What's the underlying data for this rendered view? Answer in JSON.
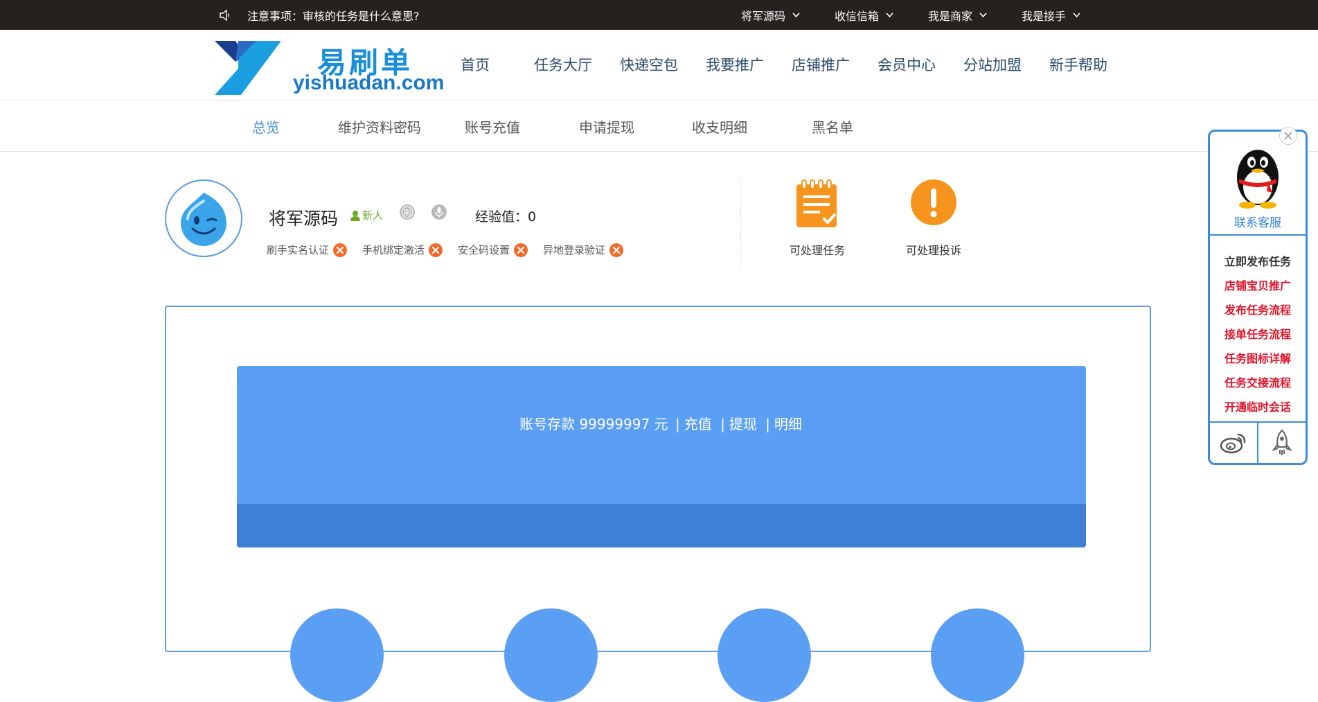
{
  "topbar": {
    "notice": "注意事项：审核的任务是什么意思?",
    "menu": [
      "将军源码",
      "收信信箱",
      "我是商家",
      "我是接手"
    ]
  },
  "logo": {
    "cn": "易刷单",
    "en": "yishuadan.com"
  },
  "nav": [
    "首页",
    "任务大厅",
    "快递空包",
    "我要推广",
    "店铺推广",
    "会员中心",
    "分站加盟",
    "新手帮助"
  ],
  "tabs": [
    "总览",
    "维护资料密码",
    "账号充值",
    "申请提现",
    "收支明细",
    "黑名单"
  ],
  "profile": {
    "name": "将军源码",
    "badge": "新人",
    "exp_label": "经验值：",
    "exp_value": "0",
    "verifications": [
      "刷手实名认证",
      "手机绑定激活",
      "安全码设置",
      "异地登录验证"
    ]
  },
  "actions": {
    "tasks": "可处理任务",
    "complaints": "可处理投诉"
  },
  "balance": {
    "label": "账号存款",
    "amount": "99999997",
    "unit": "元",
    "links": [
      "充值",
      "提现",
      "明细"
    ]
  },
  "float_panel": {
    "contact": "联系客服",
    "links": [
      "立即发布任务",
      "店铺宝贝推广",
      "发布任务流程",
      "接单任务流程",
      "任务图标详解",
      "任务交接流程",
      "开通临时会话"
    ]
  },
  "colors": {
    "accent": "#4a90d9",
    "topbar": "#24211f",
    "balance_bg": "#5b9ff4",
    "balance_dark": "#3f80d6",
    "warning": "#f7941d",
    "link_red": "#e3142a"
  }
}
